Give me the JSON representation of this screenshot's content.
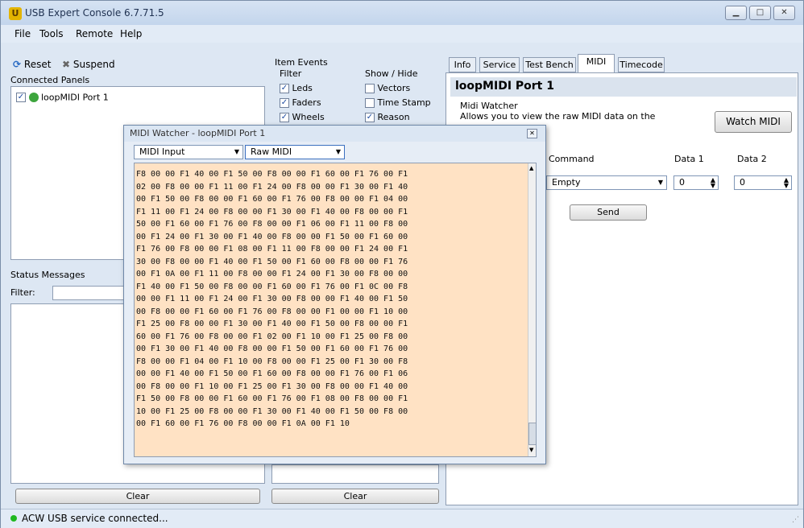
{
  "window": {
    "title": "USB Expert Console 6.7.71.5"
  },
  "menu": [
    "File",
    "Tools",
    "Remote",
    "Help"
  ],
  "toolbar": {
    "reset": "Reset",
    "suspend": "Suspend"
  },
  "connected_panels": {
    "label": "Connected Panels",
    "items": [
      "loopMIDI Port 1"
    ]
  },
  "item_events": {
    "label": "Item Events",
    "filter_label": "Filter",
    "show_hide_label": "Show / Hide",
    "filter": [
      {
        "label": "Leds",
        "checked": true
      },
      {
        "label": "Faders",
        "checked": true
      },
      {
        "label": "Wheels",
        "checked": true
      }
    ],
    "show_hide": [
      {
        "label": "Vectors",
        "checked": false
      },
      {
        "label": "Time Stamp",
        "checked": false
      },
      {
        "label": "Reason",
        "checked": true
      }
    ],
    "clear": "Clear"
  },
  "status_messages": {
    "label": "Status Messages",
    "filter_label": "Filter:",
    "clear": "Clear"
  },
  "tabs": [
    "Info",
    "Service",
    "Test Bench",
    "MIDI",
    "Timecode"
  ],
  "midi_tab": {
    "panel_title": "loopMIDI Port 1",
    "watcher_label": "Midi Watcher",
    "watcher_desc": "Allows you to view the raw MIDI data on the",
    "watch_button": "Watch MIDI",
    "command_label": "Command",
    "data1_label": "Data 1",
    "data2_label": "Data 2",
    "command_value": "Empty",
    "data1_value": "0",
    "data2_value": "0",
    "send": "Send"
  },
  "midi_watcher": {
    "title": "MIDI Watcher - loopMIDI Port 1",
    "input_select": "MIDI Input",
    "mode_select": "Raw MIDI",
    "hex_lines": [
      "F8 00 00 F1 40 00 F1 50 00 F8 00 00 F1 60 00 F1 76 00 F1",
      "02 00 F8 00 00 F1 11 00 F1 24 00 F8 00 00 F1 30 00 F1 40",
      "00 F1 50 00 F8 00 00 F1 60 00 F1 76 00 F8 00 00 F1 04 00",
      "F1 11 00 F1 24 00 F8 00 00 F1 30 00 F1 40 00 F8 00 00 F1",
      "50 00 F1 60 00 F1 76 00 F8 00 00 F1 06 00 F1 11 00 F8 00",
      "00 F1 24 00 F1 30 00 F1 40 00 F8 00 00 F1 50 00 F1 60 00",
      "F1 76 00 F8 00 00 F1 08 00 F1 11 00 F8 00 00 F1 24 00 F1",
      "30 00 F8 00 00 F1 40 00 F1 50 00 F1 60 00 F8 00 00 F1 76",
      "00 F1 0A 00 F1 11 00 F8 00 00 F1 24 00 F1 30 00 F8 00 00",
      "F1 40 00 F1 50 00 F8 00 00 F1 60 00 F1 76 00 F1 0C 00 F8",
      "00 00 F1 11 00 F1 24 00 F1 30 00 F8 00 00 F1 40 00 F1 50",
      "00 F8 00 00 F1 60 00 F1 76 00 F8 00 00 F1 00 00 F1 10 00",
      "F1 25 00 F8 00 00 F1 30 00 F1 40 00 F1 50 00 F8 00 00 F1",
      "60 00 F1 76 00 F8 00 00 F1 02 00 F1 10 00 F1 25 00 F8 00",
      "00 F1 30 00 F1 40 00 F8 00 00 F1 50 00 F1 60 00 F1 76 00",
      "F8 00 00 F1 04 00 F1 10 00 F8 00 00 F1 25 00 F1 30 00 F8",
      "00 00 F1 40 00 F1 50 00 F1 60 00 F8 00 00 F1 76 00 F1 06",
      "00 F8 00 00 F1 10 00 F1 25 00 F1 30 00 F8 00 00 F1 40 00",
      "F1 50 00 F8 00 00 F1 60 00 F1 76 00 F1 08 00 F8 00 00 F1",
      "10 00 F1 25 00 F8 00 00 F1 30 00 F1 40 00 F1 50 00 F8 00",
      "00 F1 60 00 F1 76 00 F8 00 00 F1 0A 00 F1 10"
    ]
  },
  "statusbar": {
    "text": "ACW USB service connected..."
  }
}
